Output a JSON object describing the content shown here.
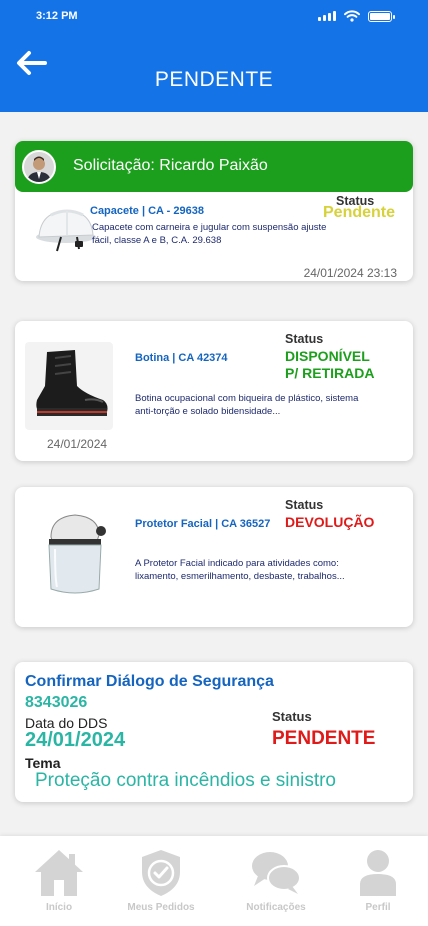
{
  "status_bar": {
    "time": "3:12 PM"
  },
  "header": {
    "title": "PENDENTE"
  },
  "request_card": {
    "banner": "Solicitação: Ricardo Paixão",
    "item_title": "Capacete | CA - 29638",
    "description": "Capacete com carneira e jugular com  suspensão ajuste fácil, classe A e B, C.A. 29.638",
    "status_label": "Status",
    "status_value": "Pendente",
    "status_color": "#d7d23a",
    "datetime": "24/01/2024 23:13"
  },
  "boot_card": {
    "date": "24/01/2024",
    "item_title": "Botina | CA 42374",
    "status_label": "Status",
    "status_line1": "DISPONÍVEL",
    "status_line2": "P/ RETIRADA",
    "status_color": "#1c9f1c",
    "description": "Botina ocupacional com biqueira de plástico, sistema anti-torção e solado bidensidade..."
  },
  "shield_card": {
    "item_title": "Protetor Facial | CA 36527",
    "status_label": "Status",
    "status_value": "DEVOLUÇÃO",
    "status_color": "#e01919",
    "description": "A Protetor Facial indicado para atividades como: lixamento, esmerilhamento, desbaste, trabalhos..."
  },
  "dds_card": {
    "title": "Confirmar Diálogo de Segurança",
    "code": "8343026",
    "date_label": "Data do DDS",
    "date_value": "24/01/2024",
    "status_label": "Status",
    "status_value": "PENDENTE",
    "theme_label": "Tema",
    "theme_value": "Proteção contra incêndios e sinistro",
    "teal_color": "#2bb5a5",
    "red_color": "#e01919"
  },
  "bottom_nav": {
    "items": [
      {
        "label": "Início",
        "icon": "home-icon"
      },
      {
        "label": "Meus Pedidos",
        "icon": "shield-check-icon"
      },
      {
        "label": "Notificações",
        "icon": "chat-bubbles-icon"
      },
      {
        "label": "Perfil",
        "icon": "user-icon"
      }
    ]
  },
  "colors": {
    "header_blue": "#1473e6",
    "banner_green": "#1c9f1c",
    "link_blue": "#1565c0"
  }
}
